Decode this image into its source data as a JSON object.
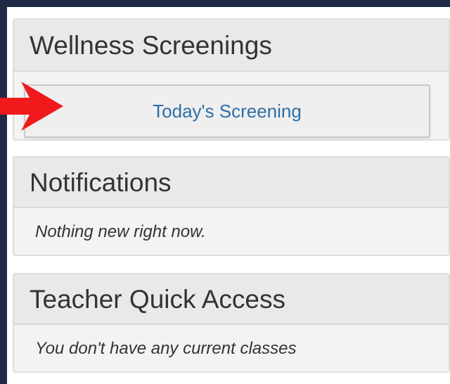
{
  "panels": {
    "wellness": {
      "title": "Wellness Screenings",
      "button_label": "Today's Screening"
    },
    "notifications": {
      "title": "Notifications",
      "empty_message": "Nothing new right now."
    },
    "teacher_quick_access": {
      "title": "Teacher Quick Access",
      "empty_message": "You don't have any current classes"
    }
  },
  "annotation": {
    "arrow_icon": "red-arrow-icon",
    "arrow_color": "#f0191b"
  },
  "colors": {
    "background": "#1f2a44",
    "link_blue": "#2f6ea6",
    "panel_header_bg": "#e9e9e9",
    "panel_body_bg": "#f3f3f3"
  }
}
